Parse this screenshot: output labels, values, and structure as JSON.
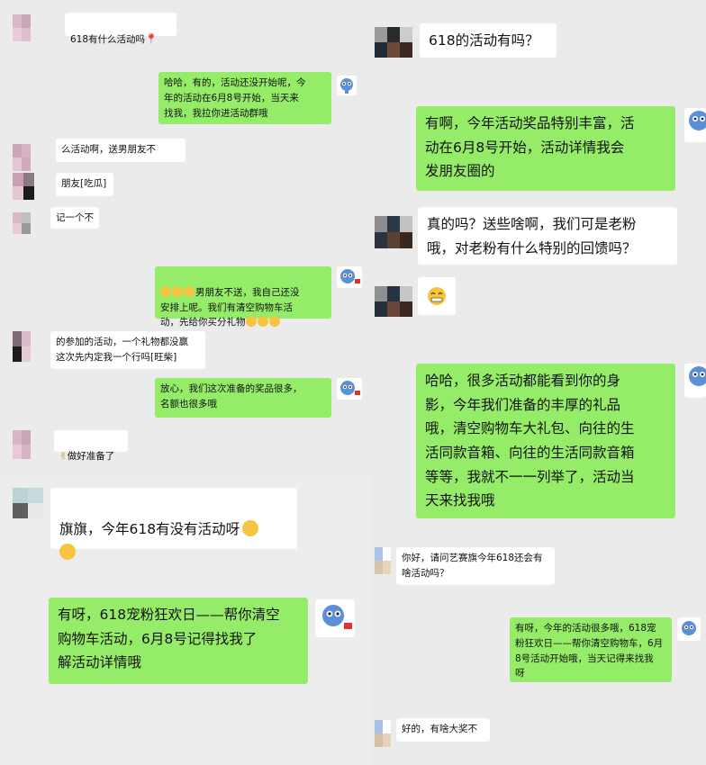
{
  "left_chat": {
    "messages": [
      {
        "side": "in",
        "text": "618有什么活动吗"
      },
      {
        "side": "out",
        "text": "哈哈，有的，活动还没开始呢，今\n年的活动在6月8号开始，当天来\n找我，我拉你进活动群哦"
      },
      {
        "side": "in",
        "text": "么活动啊，送男朋友不"
      },
      {
        "side": "in",
        "text": "朋友[吃瓜]"
      },
      {
        "side": "in",
        "text": "记一个不"
      },
      {
        "side": "out",
        "text": "男朋友不送，我自己还没\n安排上呢。我们有清空购物车活\n动，先给你买分礼物"
      },
      {
        "side": "in",
        "text": "的参加的活动，一个礼物都没赢\n这次先内定我一个行吗[旺柴]"
      },
      {
        "side": "out",
        "text": "放心，我们这次准备的奖品很多，\n名额也很多哦"
      },
      {
        "side": "in",
        "text": "做好准备了"
      }
    ]
  },
  "right_chat": {
    "messages": [
      {
        "side": "in",
        "text": "618的活动有吗？"
      },
      {
        "side": "out",
        "text": "有啊，今年活动奖品特别丰富，活\n动在6月8号开始，活动详情我会\n发朋友圈的"
      },
      {
        "side": "in",
        "text": "真的吗？送些啥啊，我们可是老粉\n哦，对老粉有什么特别的回馈吗？"
      },
      {
        "side": "out",
        "text": "哈哈，很多活动都能看到你的身\n影，今年我们准备的丰厚的礼品\n哦，清空购物车大礼包、向往的生\n活同款音箱、向往的生活同款音箱\n等等，我就不一一列举了，活动当\n天来找我哦"
      }
    ]
  },
  "bottom_left_chat": {
    "messages": [
      {
        "side": "in",
        "text": "旗旗，今年618有没有活动呀"
      },
      {
        "side": "out",
        "text": "有呀，618宠粉狂欢日——帮你清空\n购物车活动，6月8号记得找我了\n解活动详情哦"
      }
    ]
  },
  "bottom_right_chat": {
    "messages": [
      {
        "side": "in",
        "text": "你好，请问艺赛旗今年618还会有\n啥活动吗？"
      },
      {
        "side": "out",
        "text": "有呀，今年的活动很多哦，618宠\n粉狂欢日——帮你清空购物车，6月\n8号活动开始哦，当天记得来找我\n呀"
      },
      {
        "side": "in",
        "text": "好的，有啥大奖不"
      }
    ]
  },
  "icons": {
    "mascot": "mascot-avatar-icon",
    "grin": "grin-emoji-icon",
    "laugh": "laugh-cry-emoji-icon",
    "pin": "pin-emoji-icon"
  },
  "colors": {
    "out_bubble": "#95ec69",
    "in_bubble": "#ffffff",
    "chat_bg": "#ebebeb"
  }
}
